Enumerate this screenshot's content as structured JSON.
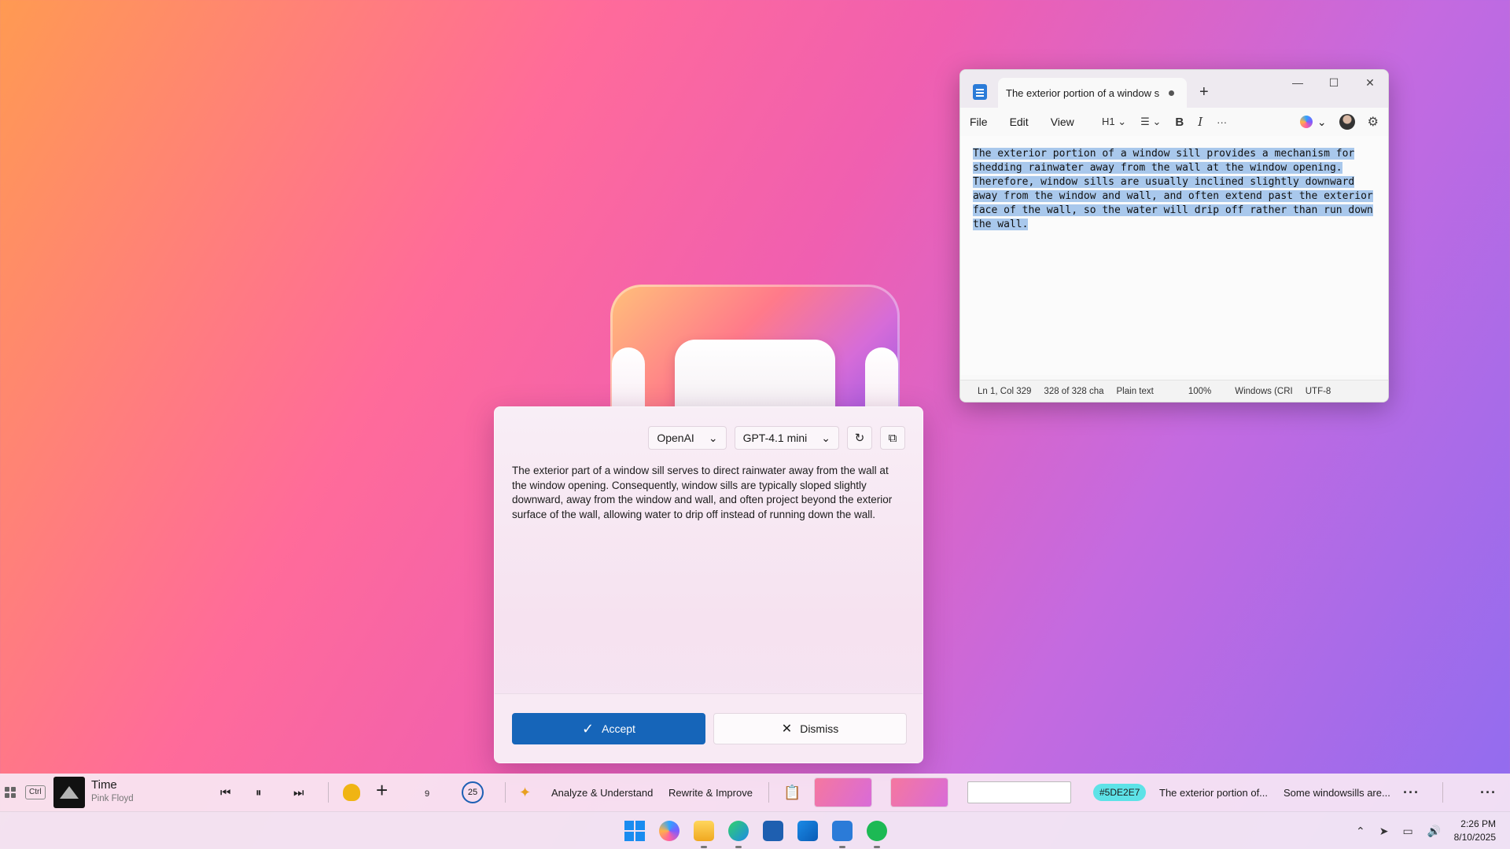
{
  "notepad": {
    "tab_title": "The exterior portion of a window s",
    "new_tab": "+",
    "window_controls": {
      "minimize": "—",
      "maximize": "☐",
      "close": "✕"
    },
    "menu": [
      "File",
      "Edit",
      "View"
    ],
    "tools": {
      "heading": "H1",
      "list": "☰",
      "bold": "B",
      "italic": "I",
      "more": "···"
    },
    "content": "The exterior portion of a window sill provides a mechanism for shedding rainwater away from the wall at the window opening. Therefore, window sills are usually inclined slightly downward away from the window and wall, and often extend past the exterior face of the wall, so the water will drip off rather than run down the wall.",
    "status": {
      "position": "Ln 1, Col 329",
      "chars": "328 of 328 cha",
      "format": "Plain text",
      "zoom": "100%",
      "line_ending": "Windows (CRI",
      "encoding": "UTF-8"
    }
  },
  "ai_panel": {
    "provider": "OpenAI",
    "model": "GPT-4.1 mini",
    "result_text": "The exterior part of a window sill serves to direct rainwater away from the wall at the window opening. Consequently, window sills are typically sloped slightly downward, away from the window and wall, and often project beyond the exterior surface of the wall, allowing water to drip off instead of running down the wall.",
    "accept_label": "Accept",
    "dismiss_label": "Dismiss"
  },
  "strip": {
    "ctrl_label": "Ctrl",
    "track_title": "Time",
    "track_artist": "Pink Floyd",
    "timer_a": "9",
    "timer_b": "25",
    "action_analyze": "Analyze & Understand",
    "action_rewrite": "Rewrite & Improve",
    "color_chip": "#5DE2E7",
    "clip_1": "The exterior portion of...",
    "clip_2": "Some windowsills are...",
    "more": "···"
  },
  "taskbar": {
    "time": "2:26 PM",
    "date": "8/10/2025"
  }
}
